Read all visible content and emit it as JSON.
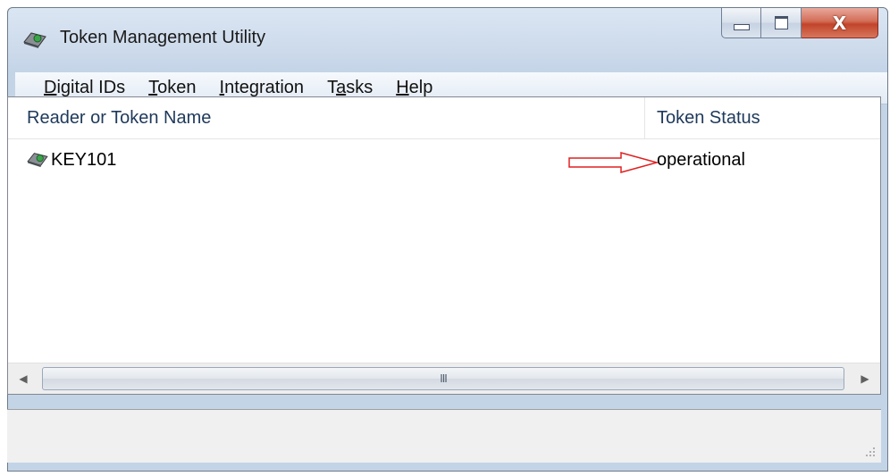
{
  "window": {
    "title": "Token Management Utility",
    "app_icon": "token-reader-icon"
  },
  "caption_buttons": {
    "minimize": "minimize-icon",
    "maximize": "maximize-icon",
    "close_glyph": "X"
  },
  "menu": {
    "items": [
      {
        "label": "Digital IDs",
        "underline": "D",
        "rest": "igital IDs"
      },
      {
        "label": "Token",
        "underline": "T",
        "rest": "oken"
      },
      {
        "label": "Integration",
        "underline": "I",
        "rest": "ntegration"
      },
      {
        "label": "Tasks",
        "pre": "T",
        "underline": "a",
        "rest": "sks"
      },
      {
        "label": "Help",
        "underline": "H",
        "rest": "elp"
      }
    ]
  },
  "list": {
    "columns": [
      "Reader or Token Name",
      "Token Status"
    ],
    "rows": [
      {
        "name": "KEY101",
        "status": "operational",
        "icon": "token-reader-icon",
        "annotation": "red-outline-arrow"
      }
    ]
  },
  "scrollbar": {
    "grip": "III"
  },
  "statusbar": {
    "text": ""
  },
  "colors": {
    "annotation_arrow": "#e02020",
    "header_text": "#1e395b"
  }
}
